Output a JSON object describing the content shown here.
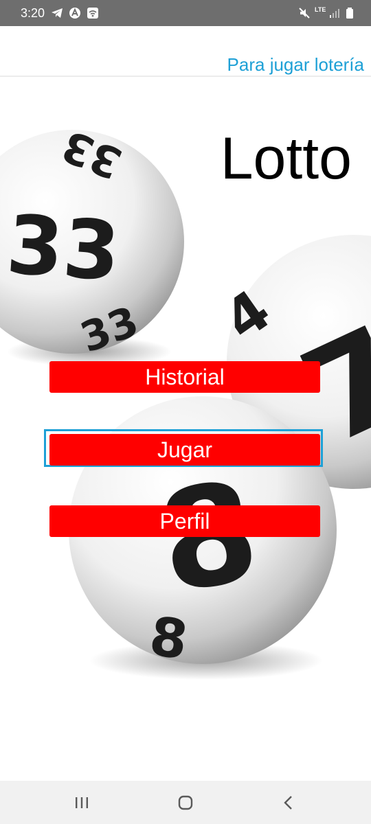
{
  "status_bar": {
    "time": "3:20",
    "network_label": "LTE",
    "icons": [
      "telegram-icon",
      "app-a-icon",
      "wifi-box-icon",
      "mute-icon",
      "lte-icon",
      "signal-icon",
      "battery-icon"
    ],
    "background": "#6e6e6e"
  },
  "header": {
    "subtitle": "Para jugar lotería",
    "subtitle_color": "#1ea0d6"
  },
  "main": {
    "title": "Lotto",
    "background_balls": [
      "33",
      "33",
      "7",
      "8",
      "8"
    ],
    "buttons": [
      {
        "label": "Historial",
        "focused": false
      },
      {
        "label": "Jugar",
        "focused": true
      },
      {
        "label": "Perfil",
        "focused": false
      }
    ],
    "button_color": "#ff0000",
    "focus_color": "#1ea0d6"
  },
  "nav_bar": {
    "icons": [
      "recent-apps-icon",
      "home-icon",
      "back-icon"
    ]
  }
}
